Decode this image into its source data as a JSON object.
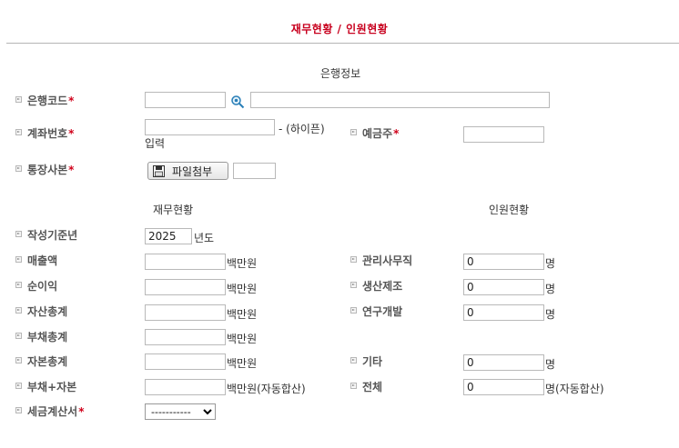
{
  "page": {
    "title": "재무현황 / 인원현황"
  },
  "bank": {
    "section_title": "은행정보",
    "bank_code_label": "은행코드",
    "account_no_label": "계좌번호",
    "account_hint": "- (하이픈)",
    "account_hint2": "입력",
    "depositor_label": "예금주",
    "bankbook_label": "통장사본",
    "file_button_label": "파일첨부",
    "required_mark": "*"
  },
  "finance": {
    "section_title": "재무현황",
    "year_label": "작성기준년",
    "year_value": "2025",
    "year_unit": "년도",
    "unit": "백만원",
    "unit_auto": "백만원(자동합산)",
    "rows": [
      {
        "label": "매출액"
      },
      {
        "label": "순이익"
      },
      {
        "label": "자산총계"
      },
      {
        "label": "부채총계"
      },
      {
        "label": "자본총계"
      },
      {
        "label": "부채+자본"
      }
    ],
    "tax_invoice_label": "세금계산서",
    "tax_invoice_selected": "-----------"
  },
  "staff": {
    "section_title": "인원현황",
    "unit": "명",
    "unit_auto": "명(자동합산)",
    "rows": [
      {
        "label": "관리사무직",
        "value": "0"
      },
      {
        "label": "생산제조",
        "value": "0"
      },
      {
        "label": "연구개발",
        "value": "0"
      },
      {
        "label": "기타",
        "value": "0"
      },
      {
        "label": "전체",
        "value": "0"
      }
    ]
  },
  "colors": {
    "title": "#c8001e",
    "required": "#d0021b",
    "label": "#555555"
  }
}
